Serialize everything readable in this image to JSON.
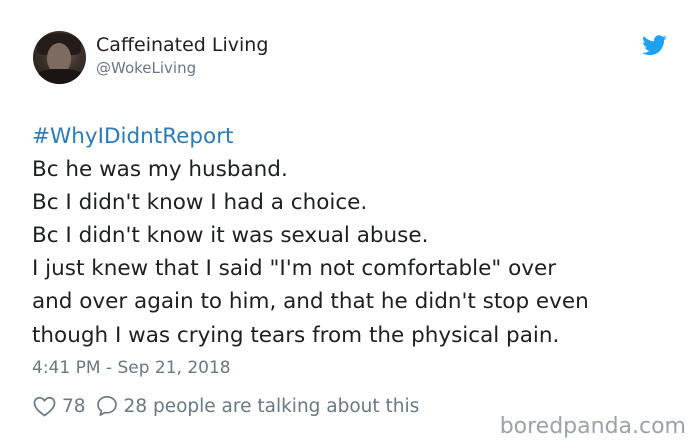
{
  "author": {
    "display_name": "Caffeinated Living",
    "handle": "@WokeLiving",
    "avatar_icon": "profile-photo"
  },
  "brand": {
    "icon": "twitter-bird-icon",
    "color": "#1da1f2"
  },
  "tweet": {
    "hashtag": "#WhyIDidntReport",
    "lines": [
      "Bc he was my husband.",
      "Bc I didn't know I had a choice.",
      "Bc I didn't know it was sexual abuse.",
      "I just knew that I said \"I'm not comfortable\" over",
      "and over again to him, and that he didn't stop even",
      "though I was crying tears from the physical pain."
    ],
    "hashtag_color": "#2b7bb9"
  },
  "meta": {
    "timestamp": "4:41 PM - Sep 21, 2018"
  },
  "engagement": {
    "likes": "78",
    "replies_text": "28 people are talking about this"
  },
  "watermark": {
    "text": "boredpanda.com"
  }
}
